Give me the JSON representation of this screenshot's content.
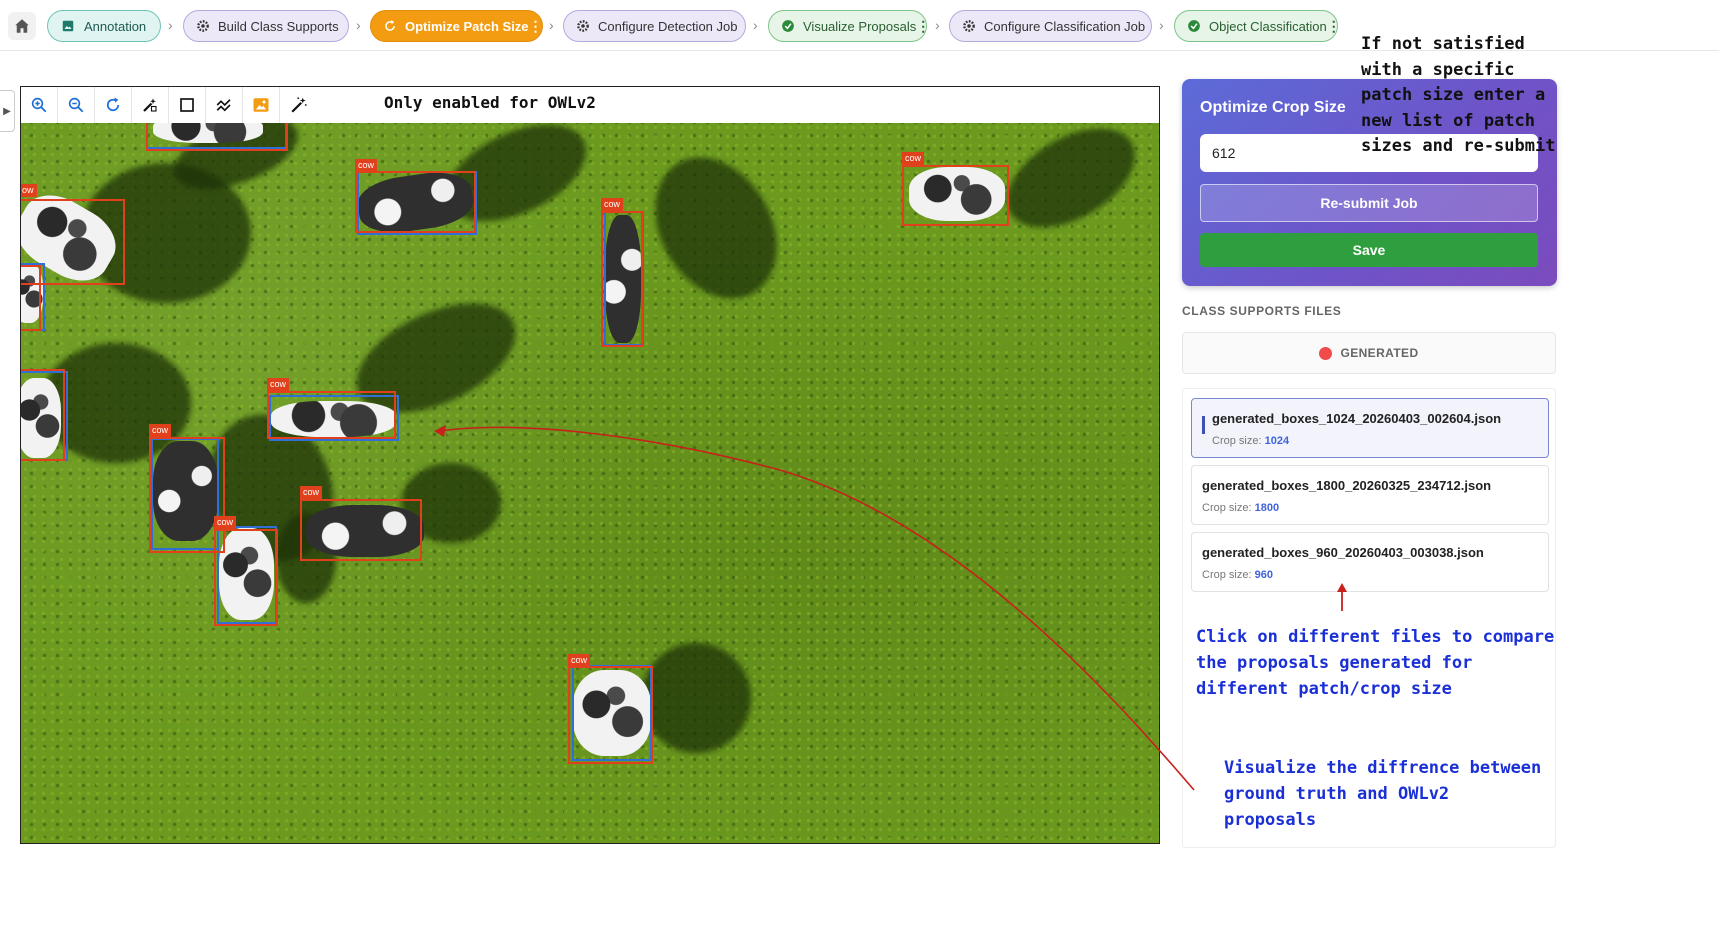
{
  "workflow": {
    "steps": [
      {
        "label": "Annotation",
        "icon": "image-icon",
        "state": "done",
        "color": "#e0f4f1"
      },
      {
        "label": "Build Class Supports",
        "icon": "gear-icon",
        "state": "idle",
        "color": "#ece8f7"
      },
      {
        "label": "Optimize Patch Size",
        "icon": "refresh-icon",
        "state": "active",
        "color": "#f39c12"
      },
      {
        "label": "Configure Detection Job",
        "icon": "gear-icon",
        "state": "idle",
        "color": "#ece8f7"
      },
      {
        "label": "Visualize Proposals",
        "icon": "check-circle-icon",
        "state": "complete",
        "color": "#e6f5e8"
      },
      {
        "label": "Configure Classification Job",
        "icon": "gear-icon",
        "state": "idle",
        "color": "#ece8f7"
      },
      {
        "label": "Object Classification",
        "icon": "check-circle-icon",
        "state": "complete",
        "color": "#e6f5e8"
      }
    ]
  },
  "viewer": {
    "note": "Only enabled for OWLv2",
    "tools": [
      "zoom-in-icon",
      "zoom-out-icon",
      "reset-icon",
      "magic-edit-icon",
      "rectangle-icon",
      "line-icon",
      "image-icon",
      "magic-wand-icon"
    ],
    "detection_label": "cow",
    "partial_label": "ow",
    "colors": {
      "ground_truth": "#2f6fd6",
      "proposal": "#e0401b"
    }
  },
  "panel": {
    "title": "Optimize Crop Size",
    "crop_value": "612",
    "resubmit_label": "Re-submit Job",
    "save_label": "Save",
    "section_title": "CLASS SUPPORTS FILES",
    "generated_label": "GENERATED",
    "crop_prefix": "Crop size:",
    "files": [
      {
        "name": "generated_boxes_1024_20260403_002604.json",
        "crop": "1024",
        "selected": true
      },
      {
        "name": "generated_boxes_1800_20260325_234712.json",
        "crop": "1800",
        "selected": false
      },
      {
        "name": "generated_boxes_960_20260403_003038.json",
        "crop": "960",
        "selected": false
      }
    ]
  },
  "annotations": {
    "patch_note": "If not satisfied with a specific patch size enter a new list of patch sizes and re-submit",
    "files_note": "Click on different files to compare the proposals generated for different patch/crop size",
    "diff_note": "Visualize the diffrence between ground truth and OWLv2 proposals"
  }
}
